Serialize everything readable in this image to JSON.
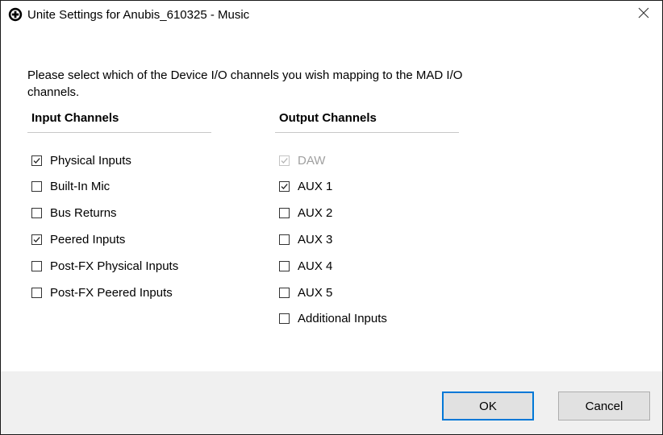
{
  "window": {
    "title": "Unite Settings for Anubis_610325 - Music",
    "app_icon": "circle-plus-icon",
    "close_icon": "close-icon"
  },
  "prompt": "Please select which of the Device I/O channels you wish mapping to the MAD I/O channels.",
  "input_channels": {
    "header": "Input Channels",
    "items": [
      {
        "label": "Physical Inputs",
        "checked": true,
        "enabled": true
      },
      {
        "label": "Built-In Mic",
        "checked": false,
        "enabled": true
      },
      {
        "label": "Bus Returns",
        "checked": false,
        "enabled": true
      },
      {
        "label": "Peered Inputs",
        "checked": true,
        "enabled": true
      },
      {
        "label": "Post-FX Physical Inputs",
        "checked": false,
        "enabled": true
      },
      {
        "label": "Post-FX Peered Inputs",
        "checked": false,
        "enabled": true
      }
    ]
  },
  "output_channels": {
    "header": "Output Channels",
    "items": [
      {
        "label": "DAW",
        "checked": true,
        "enabled": false
      },
      {
        "label": "AUX 1",
        "checked": true,
        "enabled": true
      },
      {
        "label": "AUX 2",
        "checked": false,
        "enabled": true
      },
      {
        "label": "AUX 3",
        "checked": false,
        "enabled": true
      },
      {
        "label": "AUX 4",
        "checked": false,
        "enabled": true
      },
      {
        "label": "AUX 5",
        "checked": false,
        "enabled": true
      },
      {
        "label": "Additional Inputs",
        "checked": false,
        "enabled": true
      }
    ]
  },
  "buttons": {
    "ok": "OK",
    "cancel": "Cancel"
  },
  "colors": {
    "accent": "#0078d7",
    "footer_bg": "#f0f0f0",
    "disabled_text": "#a0a0a0"
  }
}
